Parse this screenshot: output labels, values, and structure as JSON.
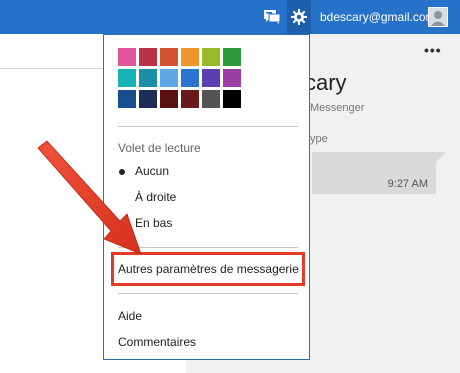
{
  "topbar": {
    "user_email": "bdescary@gmail.com",
    "chat_icon": "chat-icon",
    "settings_icon": "gear-icon",
    "avatar_icon": "avatar-icon",
    "bg_color": "#2672c9"
  },
  "background": {
    "more_label": "•••",
    "contact_name_partial": "cary",
    "contact_sub_partial": "Messenger",
    "section_partial": "ype",
    "message_time": "9:27 AM"
  },
  "settings_menu": {
    "theme_colors": [
      "#e0559b",
      "#b83346",
      "#d2522f",
      "#f0962e",
      "#98b92a",
      "#2a9a3a",
      "#ffffff",
      "#17b3b5",
      "#198ea5",
      "#5ea7e4",
      "#2c74cf",
      "#5b3fb0",
      "#9c3ea6",
      "#ffffff",
      "#1a4f8f",
      "#1e2c57",
      "#5a1010",
      "#6b1a1a",
      "#545454",
      "#000000",
      "#ffffff"
    ],
    "reading_pane_label": "Volet de lecture",
    "reading_pane_options": [
      {
        "label": "Aucun",
        "selected": true
      },
      {
        "label": "À droite",
        "selected": false
      },
      {
        "label": "En bas",
        "selected": false
      }
    ],
    "more_settings_label": "Autres paramètres de messagerie",
    "help_label": "Aide",
    "feedback_label": "Commentaires",
    "highlight_color": "#e23b26"
  }
}
